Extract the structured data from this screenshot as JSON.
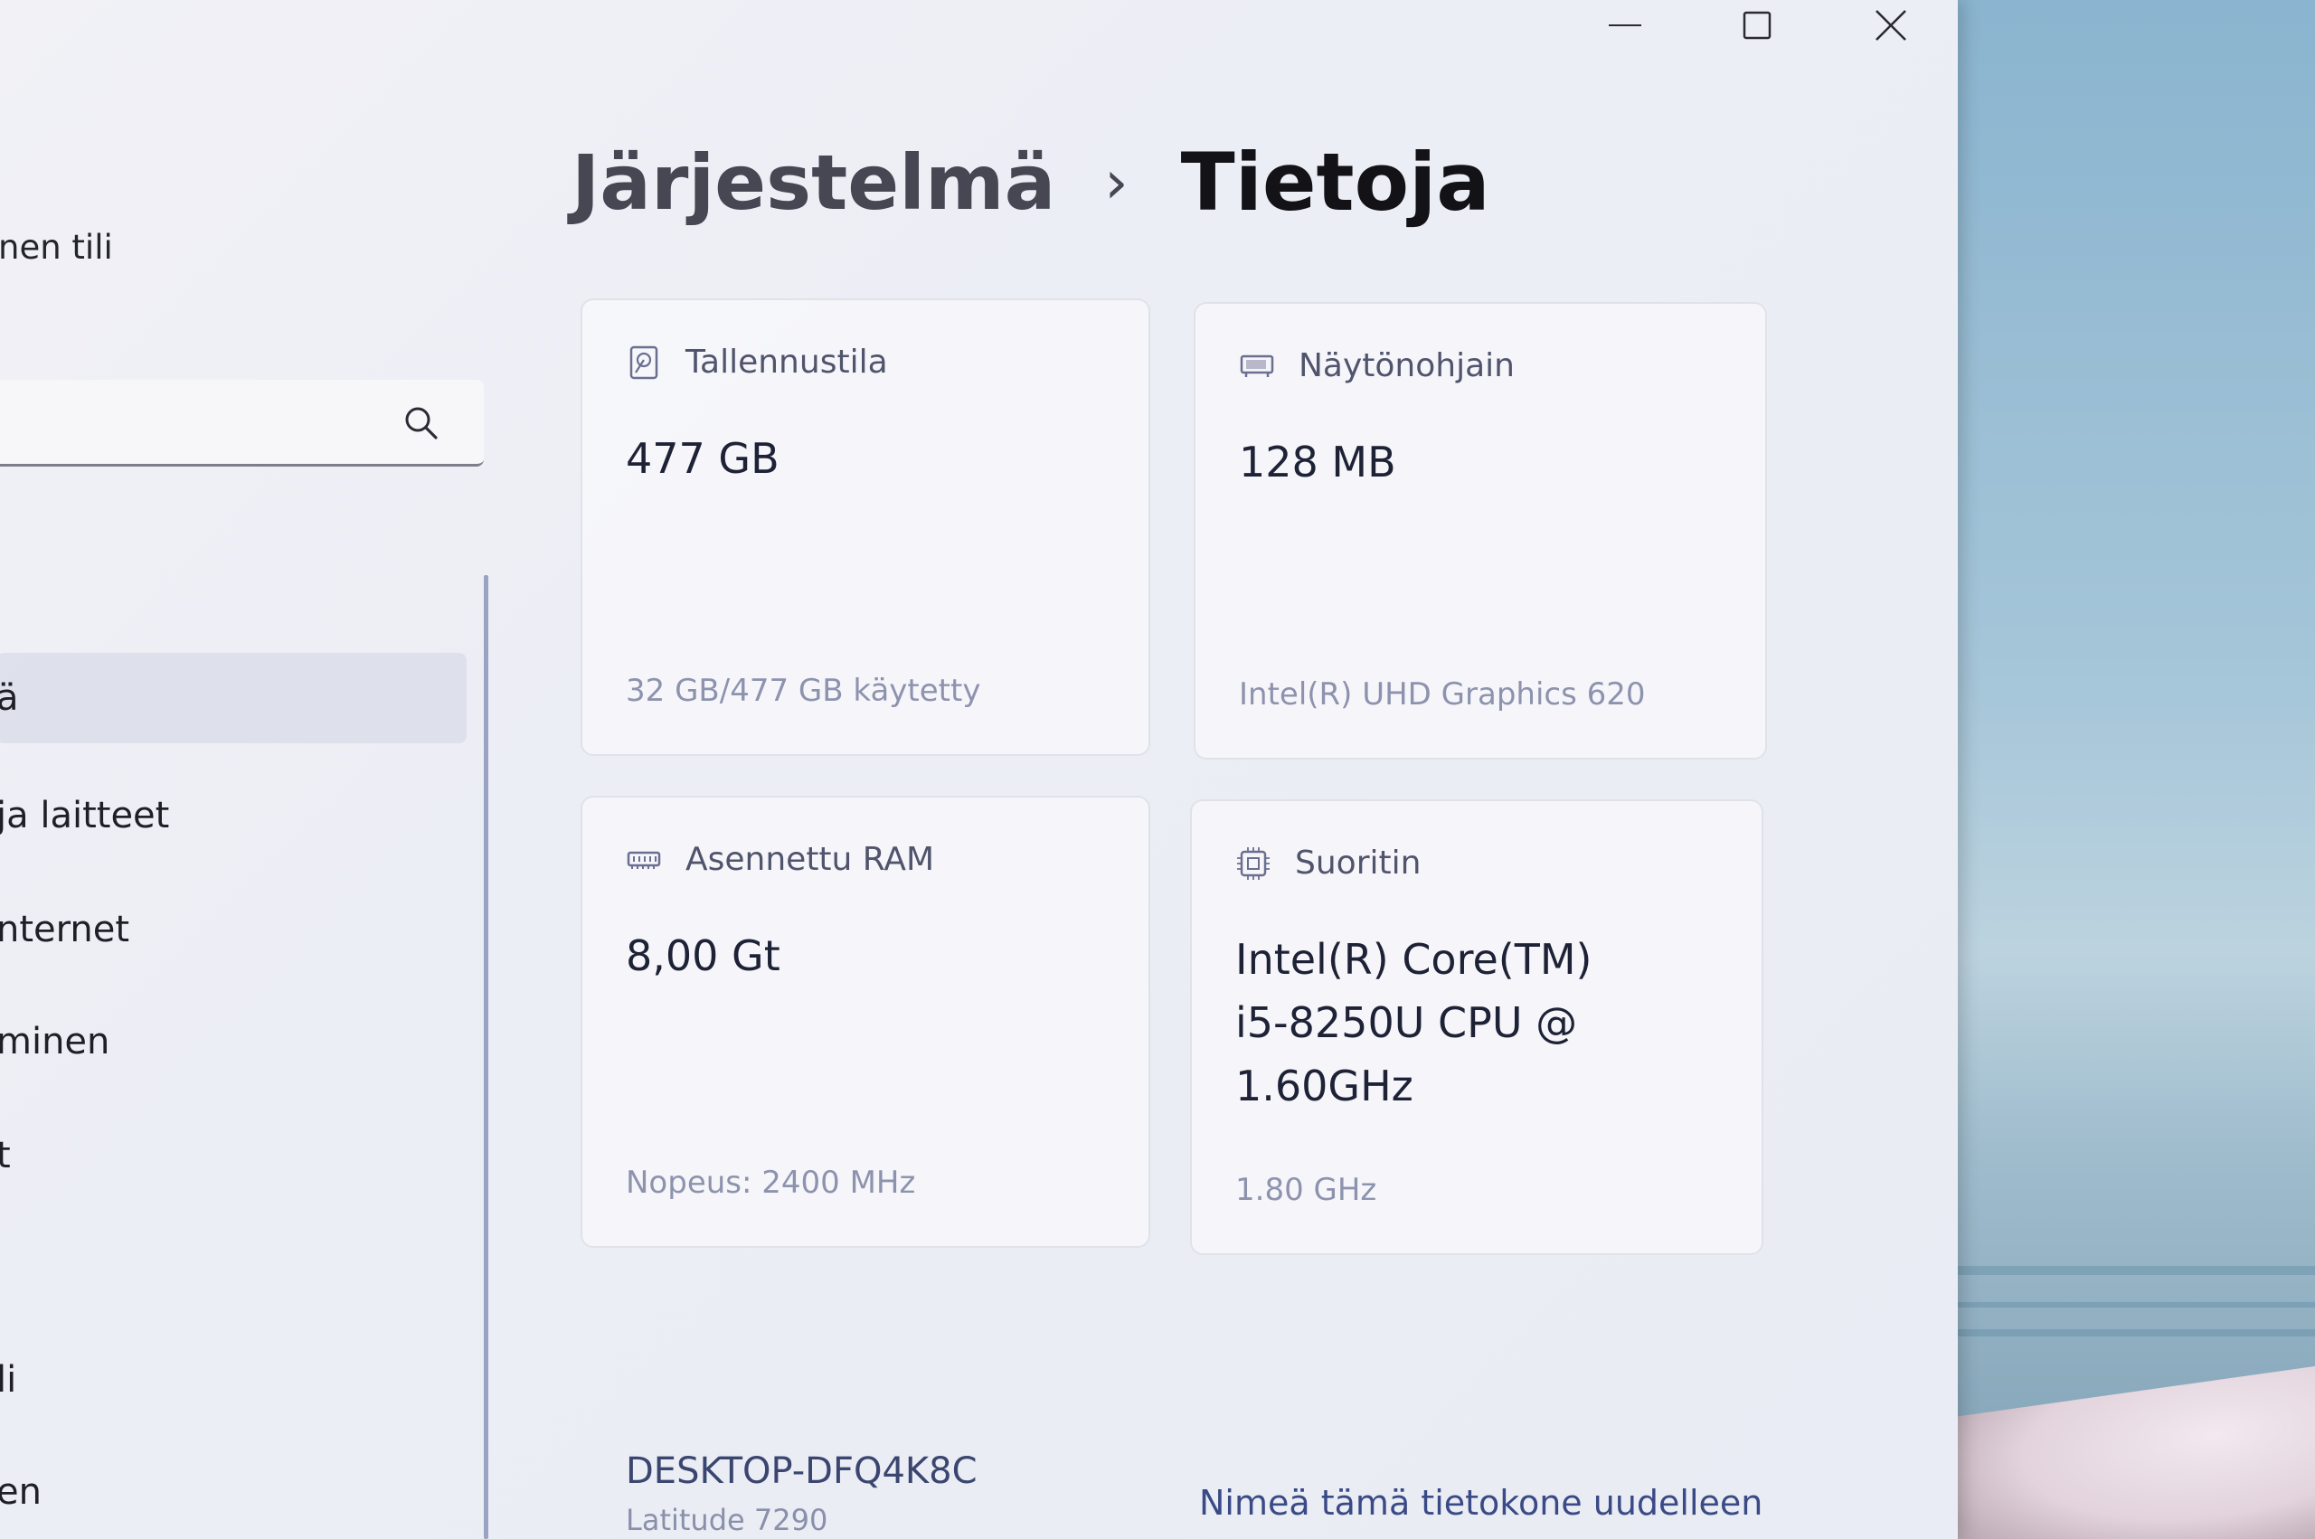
{
  "window": {
    "minimize_label": "Minimize",
    "maximize_label": "Maximize",
    "close_label": "Close"
  },
  "sidebar": {
    "account_text": "nen tili",
    "search": {
      "value": "",
      "placeholder": ""
    },
    "items": [
      {
        "label": "ä",
        "selected": true
      },
      {
        "label": "ja laitteet",
        "selected": false
      },
      {
        "label": "nternet",
        "selected": false
      },
      {
        "label": "minen",
        "selected": false
      },
      {
        "label": "t",
        "selected": false
      },
      {
        "label": "li",
        "selected": false
      },
      {
        "label": "en",
        "selected": false
      }
    ]
  },
  "breadcrumb": {
    "parent": "Järjestelmä",
    "separator": "›",
    "current": "Tietoja"
  },
  "specs": {
    "storage": {
      "icon": "storage-icon",
      "title": "Tallennustila",
      "value": "477 GB",
      "sub": "32 GB/477 GB käytetty"
    },
    "graphics": {
      "icon": "display-adapter-icon",
      "title": "Näytönohjain",
      "value": "128 MB",
      "sub": "Intel(R) UHD Graphics 620"
    },
    "ram": {
      "icon": "ram-icon",
      "title": "Asennettu RAM",
      "value": "8,00 Gt",
      "sub": "Nopeus: 2400 MHz"
    },
    "processor": {
      "icon": "processor-icon",
      "title": "Suoritin",
      "value_lines": [
        "Intel(R) Core(TM)",
        "i5-8250U CPU @",
        "1.60GHz"
      ],
      "sub": "1.80 GHz"
    }
  },
  "device": {
    "name": "DESKTOP-DFQ4K8C",
    "model": "Latitude 7290",
    "rename_label": "Nimeä tämä tietokone uudelleen"
  },
  "colors": {
    "accent": "#3a4a86",
    "rail": "#9aa3c4"
  }
}
